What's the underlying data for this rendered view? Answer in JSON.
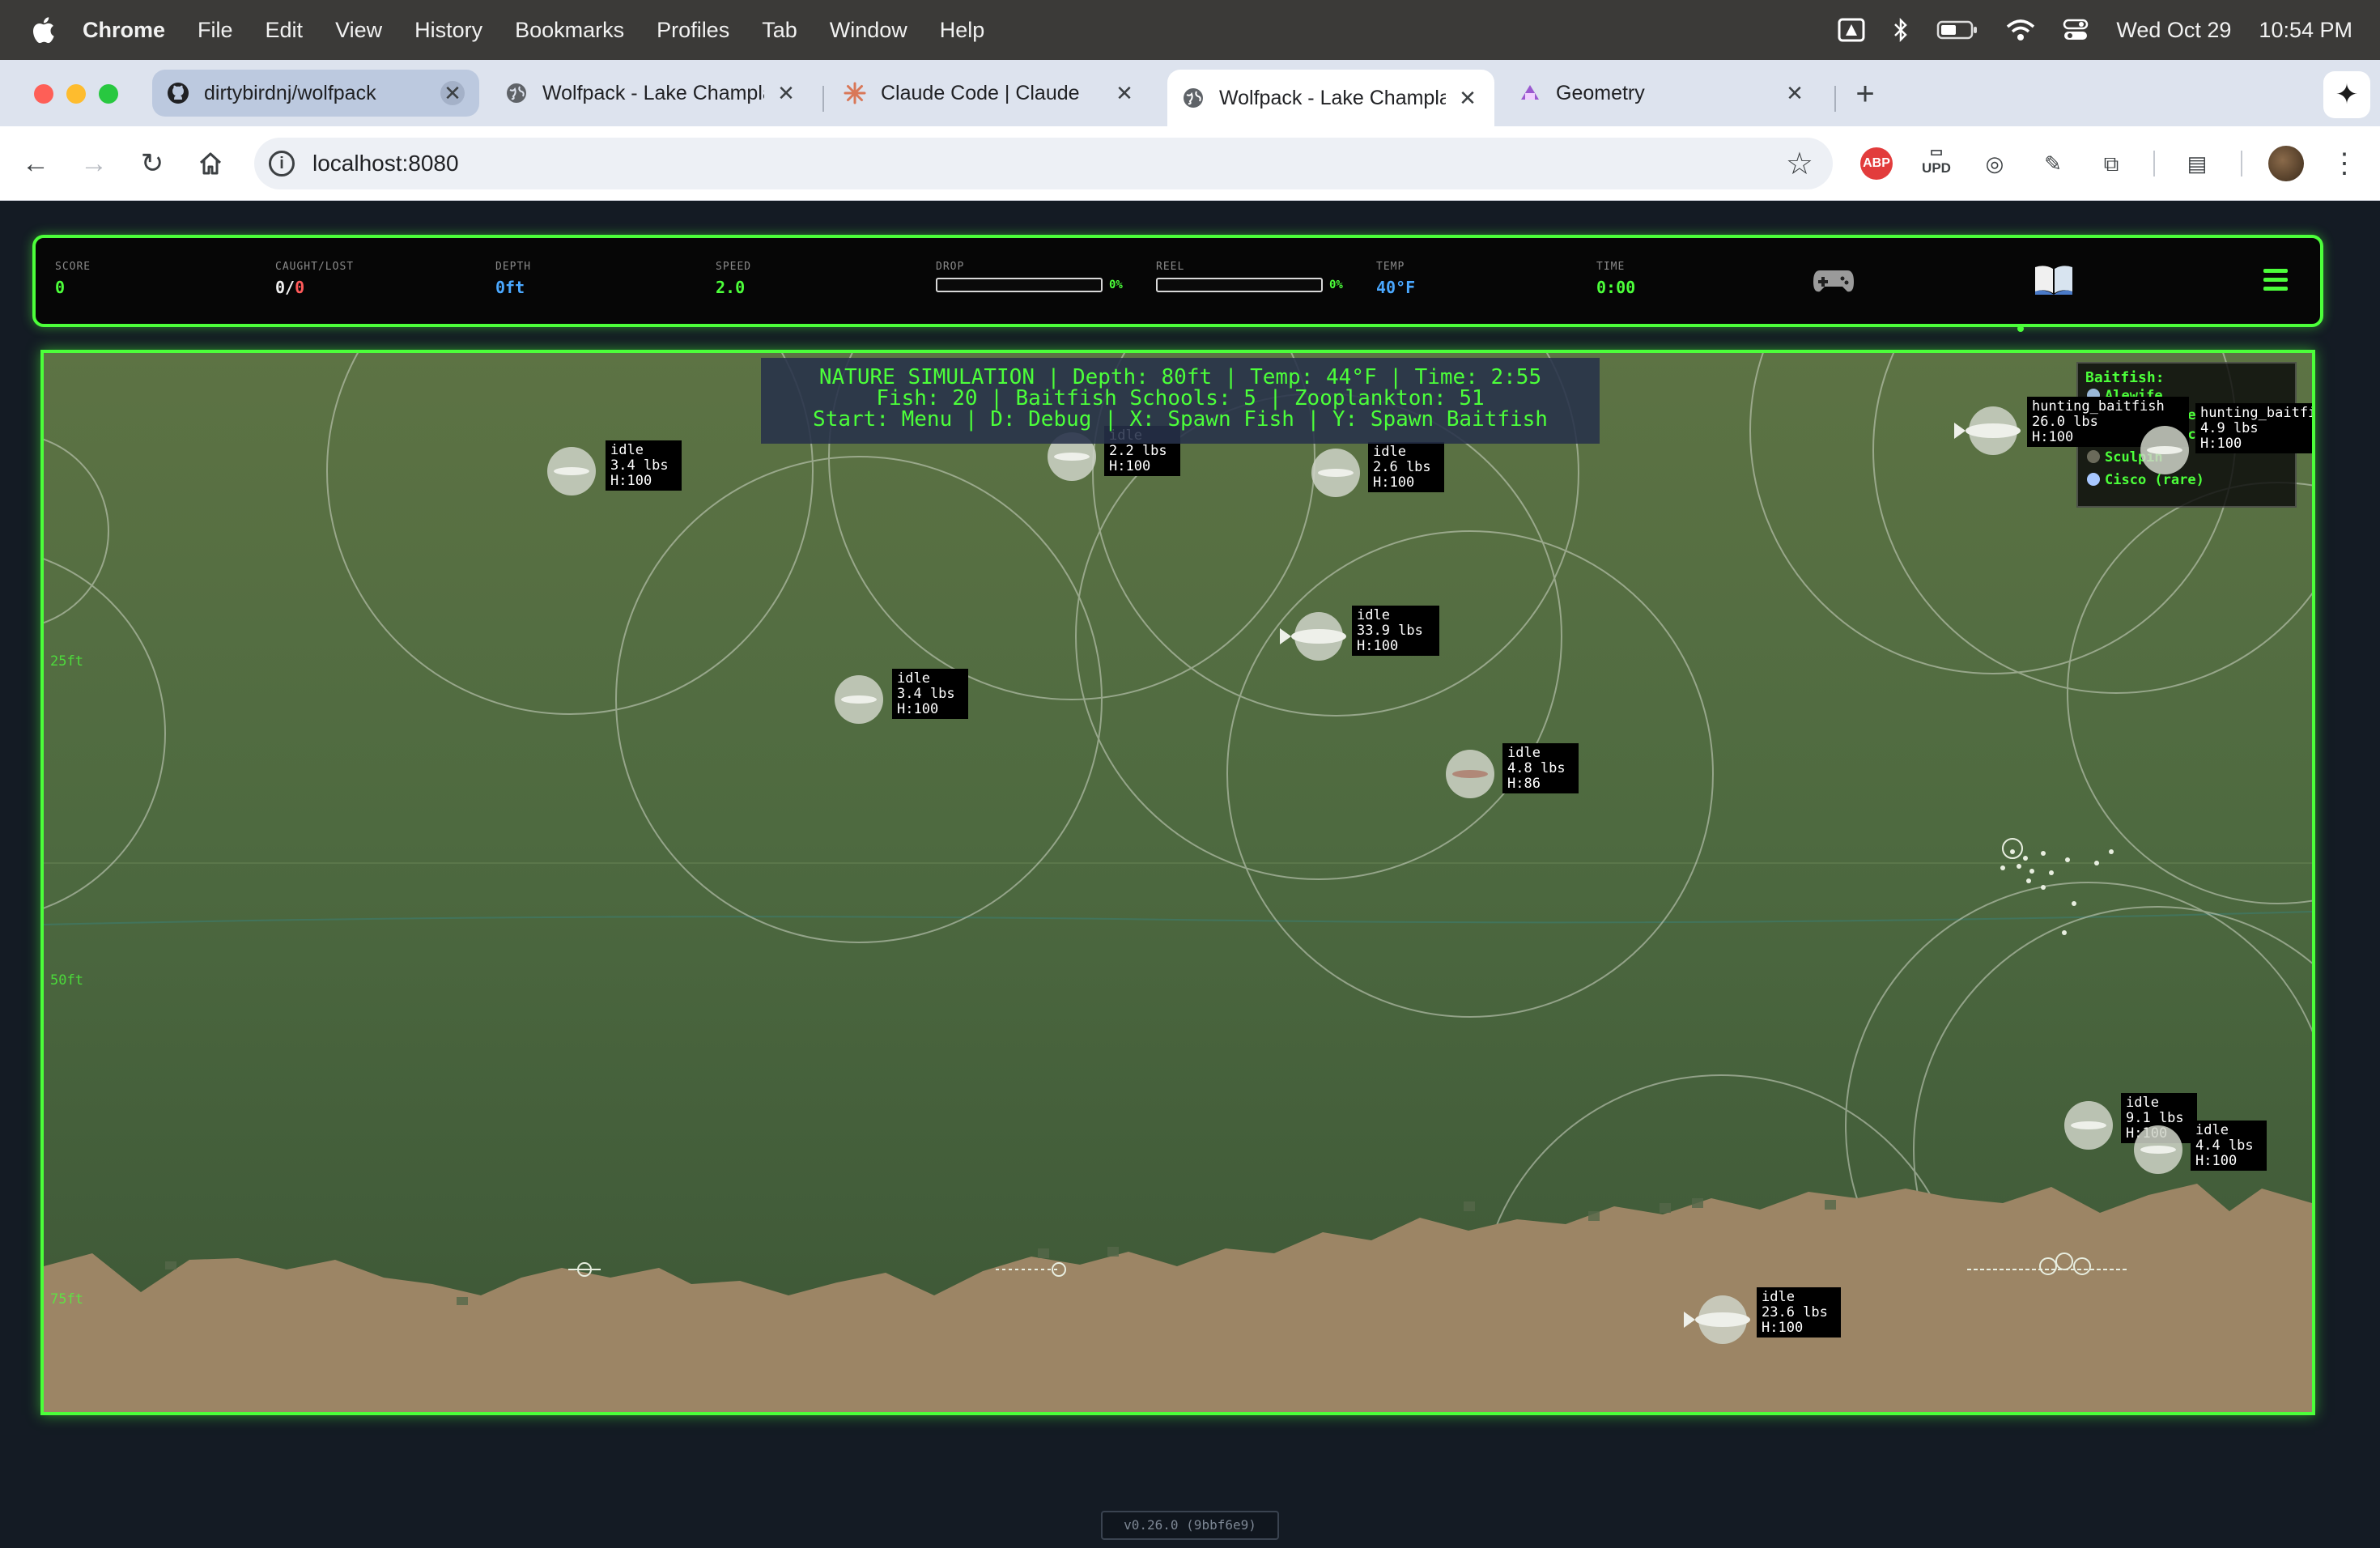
{
  "menubar": {
    "app_name": "Chrome",
    "items": [
      "File",
      "Edit",
      "View",
      "History",
      "Bookmarks",
      "Profiles",
      "Tab",
      "Window",
      "Help"
    ],
    "date": "Wed Oct 29",
    "time": "10:54 PM"
  },
  "browser": {
    "tabs": [
      {
        "title": "dirtybirdnj/wolfpack",
        "favicon": "github-icon"
      },
      {
        "title": "Wolfpack - Lake Champlain",
        "favicon": "globe-icon"
      },
      {
        "title": "Claude Code | Claude",
        "favicon": "claude-icon"
      },
      {
        "title": "Wolfpack - Lake Champlain",
        "favicon": "globe-icon"
      },
      {
        "title": "Geometry",
        "favicon": "geometry-icon"
      }
    ],
    "url": "localhost:8080",
    "upd_label": "UPD",
    "abp_label": "ABP"
  },
  "hud": {
    "score": {
      "label": "SCORE",
      "value": "0"
    },
    "caught_lost": {
      "label": "CAUGHT/LOST",
      "value": "0/0"
    },
    "depth": {
      "label": "DEPTH",
      "value": "0ft"
    },
    "speed": {
      "label": "SPEED",
      "value": "2.0"
    },
    "drop": {
      "label": "DROP",
      "percent": "0%",
      "level": 0
    },
    "reel": {
      "label": "REEL",
      "percent": "0%",
      "level": 0
    },
    "temp": {
      "label": "TEMP",
      "value": "40°F"
    },
    "time": {
      "label": "TIME",
      "value": "0:00"
    },
    "colors": {
      "accent": "#4cff3a",
      "white": "#f0f0f0",
      "red": "#ff5a5a",
      "blue": "#4aa8ff"
    }
  },
  "game": {
    "banner": [
      "NATURE SIMULATION | Depth: 80ft | Temp: 44°F | Time: 2:55",
      "Fish: 20 | Baitfish Schools: 5 | Zooplankton: 51",
      "Start: Menu | D: Debug | X: Spawn Fish | Y: Spawn Baitfish"
    ],
    "depth_markers": [
      "25ft",
      "50ft",
      "75ft"
    ],
    "legend": {
      "title": "Baitfish:",
      "items": [
        {
          "name": "Alewife",
          "color": "#9ab8d8"
        },
        {
          "name": "Rainbow Smelt",
          "color": "#b8c8c8"
        },
        {
          "name": "Yellow Perch",
          "color": "#e0c040"
        },
        {
          "name": "Sculpin",
          "color": "#6a6a5a"
        },
        {
          "name": "Cisco (rare)",
          "color": "#a8c8ff"
        }
      ]
    },
    "fish": [
      {
        "state": "idle",
        "weight": "3.4 lbs",
        "health": "H:100"
      },
      {
        "state": "idle",
        "weight": "2.2 lbs",
        "health": "H:100"
      },
      {
        "state": "idle",
        "weight": "2.6 lbs",
        "health": "H:100"
      },
      {
        "state": "idle",
        "weight": "33.9 lbs",
        "health": "H:100"
      },
      {
        "state": "idle",
        "weight": "3.4 lbs",
        "health": "H:100"
      },
      {
        "state": "idle",
        "weight": "4.8 lbs",
        "health": "H:86"
      },
      {
        "state": "hunting_baitfish",
        "weight": "26.0 lbs",
        "health": "H:100"
      },
      {
        "state": "hunting_baitfish",
        "weight": "4.9 lbs",
        "health": "H:100"
      },
      {
        "state": "idle",
        "weight": "9.1 lbs",
        "health": "H:100"
      },
      {
        "state": "idle",
        "weight": "4.4 lbs",
        "health": "H:100"
      },
      {
        "state": "idle",
        "weight": "23.6 lbs",
        "health": "H:100"
      }
    ]
  },
  "version": "v0.26.0 (9bbf6e9)"
}
